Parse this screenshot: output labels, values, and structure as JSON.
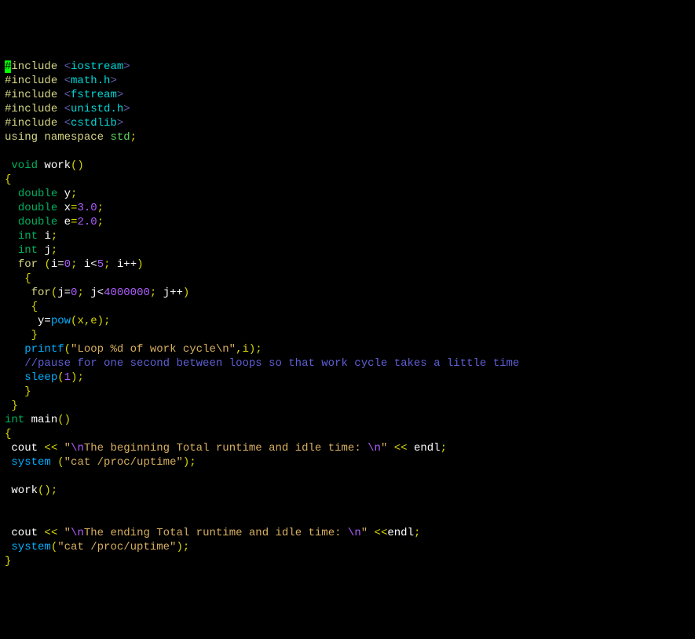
{
  "code": {
    "inc_hash": "#",
    "inc_word": "include",
    "using_kw": "using",
    "namespace_kw": "namespace",
    "std_ns": "std",
    "headers": [
      "iostream",
      "math.h",
      "fstream",
      "unistd.h",
      "cstdlib"
    ],
    "void_kw": "void",
    "work_fn": "work",
    "double_kw": "double",
    "int_kw": "int",
    "for_kw": "for",
    "int_main_kw": "int",
    "main_fn": "main",
    "var_y": "y",
    "var_x": "x",
    "var_e": "e",
    "var_i": "i",
    "var_j": "j",
    "val_3": "3.0",
    "val_2": "2.0",
    "for_i_init": "i=",
    "for_i_init_v": "0",
    "for_i_cond": "i<",
    "for_i_cond_v": "5",
    "for_i_post": "i++",
    "for_j_init": "j=",
    "for_j_init_v": "0",
    "for_j_cond": "j<",
    "for_j_cond_v": "4000000",
    "for_j_post": "j++",
    "pow_assign_lhs": "y=",
    "pow_fn": "pow",
    "pow_args": "(x,e)",
    "printf_fn": "printf",
    "printf_str": "\"Loop %d of work cycle\\n\"",
    "printf_tail": ",i);",
    "comment_pause": "//pause for one second between loops so that work cycle takes a little time",
    "sleep_fn": "sleep",
    "sleep_arg": "1",
    "cout_id": "cout",
    "endl_id": "endl",
    "begin_str_a": "\"",
    "begin_str_nl": "\\n",
    "begin_str_b": "The beginning Total runtime and idle time: ",
    "begin_str_c": "\"",
    "end_str_b": "The ending Total runtime and idle time: ",
    "system_fn": "system",
    "system_space": " ",
    "cat_str": "\"cat /proc/uptime\"",
    "work_call": "work"
  }
}
